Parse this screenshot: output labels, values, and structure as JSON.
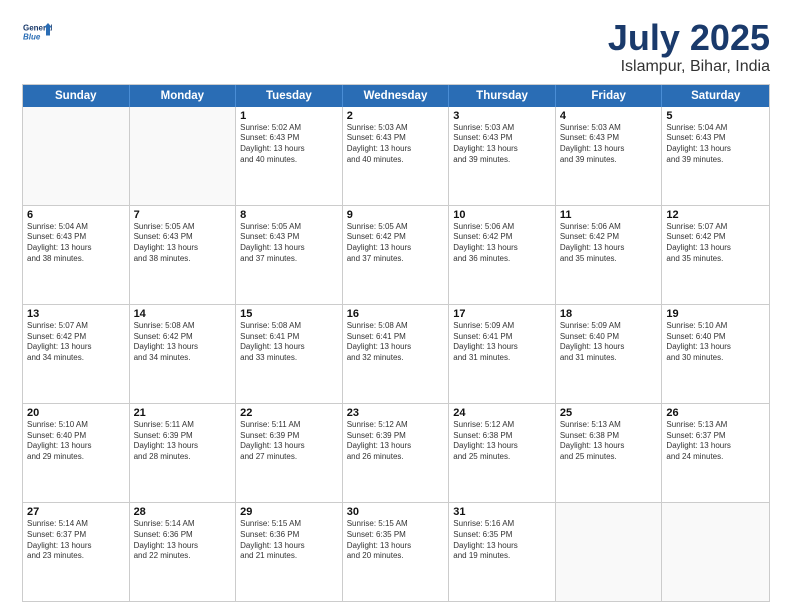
{
  "header": {
    "logo_general": "General",
    "logo_blue": "Blue",
    "month_title": "July 2025",
    "location": "Islampur, Bihar, India"
  },
  "days": [
    "Sunday",
    "Monday",
    "Tuesday",
    "Wednesday",
    "Thursday",
    "Friday",
    "Saturday"
  ],
  "rows": [
    [
      {
        "day": "",
        "empty": true
      },
      {
        "day": "",
        "empty": true
      },
      {
        "day": "1",
        "line1": "Sunrise: 5:02 AM",
        "line2": "Sunset: 6:43 PM",
        "line3": "Daylight: 13 hours",
        "line4": "and 40 minutes."
      },
      {
        "day": "2",
        "line1": "Sunrise: 5:03 AM",
        "line2": "Sunset: 6:43 PM",
        "line3": "Daylight: 13 hours",
        "line4": "and 40 minutes."
      },
      {
        "day": "3",
        "line1": "Sunrise: 5:03 AM",
        "line2": "Sunset: 6:43 PM",
        "line3": "Daylight: 13 hours",
        "line4": "and 39 minutes."
      },
      {
        "day": "4",
        "line1": "Sunrise: 5:03 AM",
        "line2": "Sunset: 6:43 PM",
        "line3": "Daylight: 13 hours",
        "line4": "and 39 minutes."
      },
      {
        "day": "5",
        "line1": "Sunrise: 5:04 AM",
        "line2": "Sunset: 6:43 PM",
        "line3": "Daylight: 13 hours",
        "line4": "and 39 minutes."
      }
    ],
    [
      {
        "day": "6",
        "line1": "Sunrise: 5:04 AM",
        "line2": "Sunset: 6:43 PM",
        "line3": "Daylight: 13 hours",
        "line4": "and 38 minutes."
      },
      {
        "day": "7",
        "line1": "Sunrise: 5:05 AM",
        "line2": "Sunset: 6:43 PM",
        "line3": "Daylight: 13 hours",
        "line4": "and 38 minutes."
      },
      {
        "day": "8",
        "line1": "Sunrise: 5:05 AM",
        "line2": "Sunset: 6:43 PM",
        "line3": "Daylight: 13 hours",
        "line4": "and 37 minutes."
      },
      {
        "day": "9",
        "line1": "Sunrise: 5:05 AM",
        "line2": "Sunset: 6:42 PM",
        "line3": "Daylight: 13 hours",
        "line4": "and 37 minutes."
      },
      {
        "day": "10",
        "line1": "Sunrise: 5:06 AM",
        "line2": "Sunset: 6:42 PM",
        "line3": "Daylight: 13 hours",
        "line4": "and 36 minutes."
      },
      {
        "day": "11",
        "line1": "Sunrise: 5:06 AM",
        "line2": "Sunset: 6:42 PM",
        "line3": "Daylight: 13 hours",
        "line4": "and 35 minutes."
      },
      {
        "day": "12",
        "line1": "Sunrise: 5:07 AM",
        "line2": "Sunset: 6:42 PM",
        "line3": "Daylight: 13 hours",
        "line4": "and 35 minutes."
      }
    ],
    [
      {
        "day": "13",
        "line1": "Sunrise: 5:07 AM",
        "line2": "Sunset: 6:42 PM",
        "line3": "Daylight: 13 hours",
        "line4": "and 34 minutes."
      },
      {
        "day": "14",
        "line1": "Sunrise: 5:08 AM",
        "line2": "Sunset: 6:42 PM",
        "line3": "Daylight: 13 hours",
        "line4": "and 34 minutes."
      },
      {
        "day": "15",
        "line1": "Sunrise: 5:08 AM",
        "line2": "Sunset: 6:41 PM",
        "line3": "Daylight: 13 hours",
        "line4": "and 33 minutes."
      },
      {
        "day": "16",
        "line1": "Sunrise: 5:08 AM",
        "line2": "Sunset: 6:41 PM",
        "line3": "Daylight: 13 hours",
        "line4": "and 32 minutes."
      },
      {
        "day": "17",
        "line1": "Sunrise: 5:09 AM",
        "line2": "Sunset: 6:41 PM",
        "line3": "Daylight: 13 hours",
        "line4": "and 31 minutes."
      },
      {
        "day": "18",
        "line1": "Sunrise: 5:09 AM",
        "line2": "Sunset: 6:40 PM",
        "line3": "Daylight: 13 hours",
        "line4": "and 31 minutes."
      },
      {
        "day": "19",
        "line1": "Sunrise: 5:10 AM",
        "line2": "Sunset: 6:40 PM",
        "line3": "Daylight: 13 hours",
        "line4": "and 30 minutes."
      }
    ],
    [
      {
        "day": "20",
        "line1": "Sunrise: 5:10 AM",
        "line2": "Sunset: 6:40 PM",
        "line3": "Daylight: 13 hours",
        "line4": "and 29 minutes."
      },
      {
        "day": "21",
        "line1": "Sunrise: 5:11 AM",
        "line2": "Sunset: 6:39 PM",
        "line3": "Daylight: 13 hours",
        "line4": "and 28 minutes."
      },
      {
        "day": "22",
        "line1": "Sunrise: 5:11 AM",
        "line2": "Sunset: 6:39 PM",
        "line3": "Daylight: 13 hours",
        "line4": "and 27 minutes."
      },
      {
        "day": "23",
        "line1": "Sunrise: 5:12 AM",
        "line2": "Sunset: 6:39 PM",
        "line3": "Daylight: 13 hours",
        "line4": "and 26 minutes."
      },
      {
        "day": "24",
        "line1": "Sunrise: 5:12 AM",
        "line2": "Sunset: 6:38 PM",
        "line3": "Daylight: 13 hours",
        "line4": "and 25 minutes."
      },
      {
        "day": "25",
        "line1": "Sunrise: 5:13 AM",
        "line2": "Sunset: 6:38 PM",
        "line3": "Daylight: 13 hours",
        "line4": "and 25 minutes."
      },
      {
        "day": "26",
        "line1": "Sunrise: 5:13 AM",
        "line2": "Sunset: 6:37 PM",
        "line3": "Daylight: 13 hours",
        "line4": "and 24 minutes."
      }
    ],
    [
      {
        "day": "27",
        "line1": "Sunrise: 5:14 AM",
        "line2": "Sunset: 6:37 PM",
        "line3": "Daylight: 13 hours",
        "line4": "and 23 minutes."
      },
      {
        "day": "28",
        "line1": "Sunrise: 5:14 AM",
        "line2": "Sunset: 6:36 PM",
        "line3": "Daylight: 13 hours",
        "line4": "and 22 minutes."
      },
      {
        "day": "29",
        "line1": "Sunrise: 5:15 AM",
        "line2": "Sunset: 6:36 PM",
        "line3": "Daylight: 13 hours",
        "line4": "and 21 minutes."
      },
      {
        "day": "30",
        "line1": "Sunrise: 5:15 AM",
        "line2": "Sunset: 6:35 PM",
        "line3": "Daylight: 13 hours",
        "line4": "and 20 minutes."
      },
      {
        "day": "31",
        "line1": "Sunrise: 5:16 AM",
        "line2": "Sunset: 6:35 PM",
        "line3": "Daylight: 13 hours",
        "line4": "and 19 minutes."
      },
      {
        "day": "",
        "empty": true
      },
      {
        "day": "",
        "empty": true
      }
    ]
  ]
}
